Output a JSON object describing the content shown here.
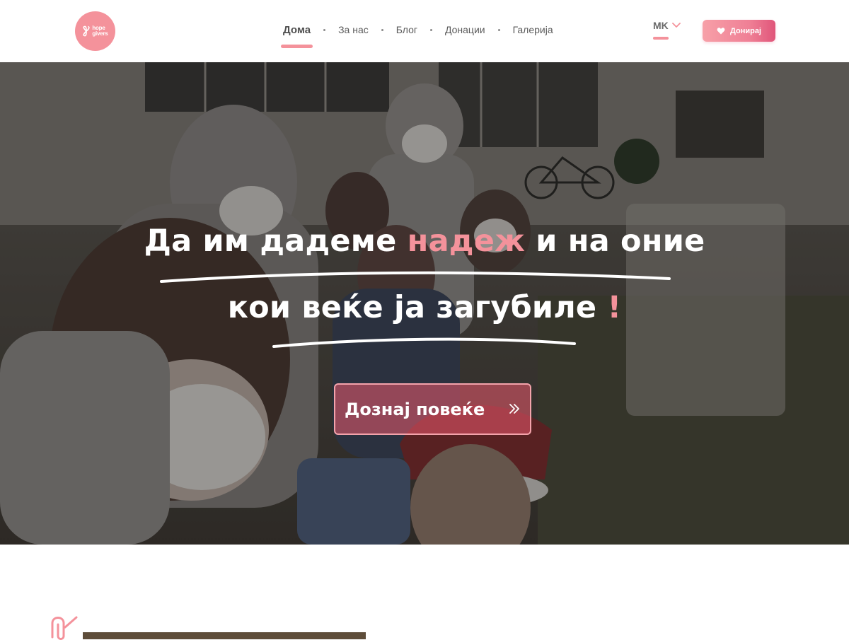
{
  "brand": {
    "logo_line1": "hope",
    "logo_line2": "givers",
    "accent_color": "#f4929b"
  },
  "nav": {
    "items": [
      {
        "label": "Дома",
        "active": true
      },
      {
        "label": "За нас"
      },
      {
        "label": "Блог"
      },
      {
        "label": "Донации"
      },
      {
        "label": "Галерија"
      }
    ]
  },
  "language": {
    "current": "MK"
  },
  "header": {
    "donate_label": "Донирај"
  },
  "hero": {
    "line1_before": "Да им дадеме ",
    "line1_accent": "надеж",
    "line1_after": " и на оние",
    "line2_text": "кои веќе ја загубиле ",
    "line2_accent": "!",
    "cta_label": "Дознај повеќе"
  },
  "icons": {
    "logo": "hope-infinity-icon",
    "language": "chevron-down-icon",
    "donate": "heart-icon",
    "cta": "double-chevron-right-icon",
    "section": "paperclip-icon"
  }
}
